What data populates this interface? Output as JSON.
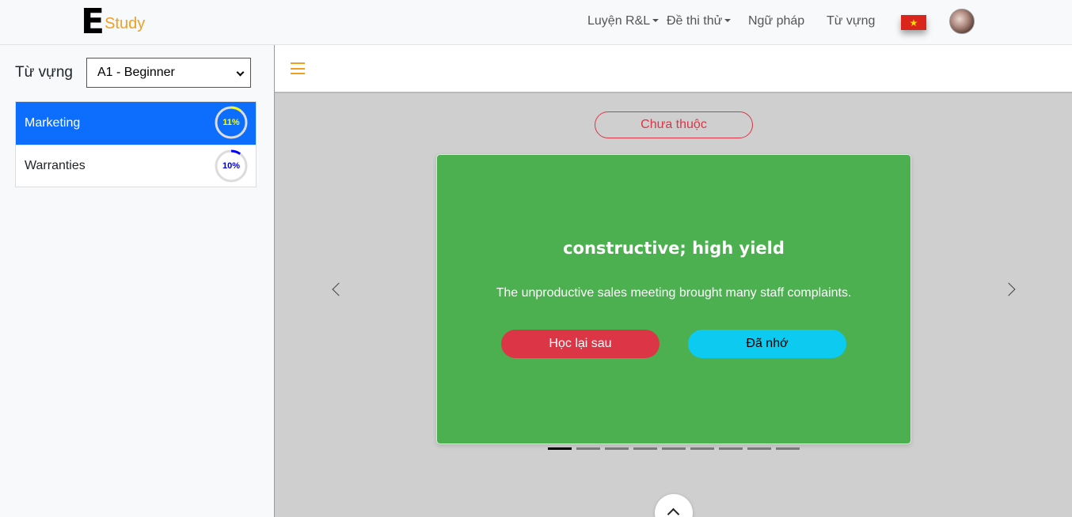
{
  "navbar": {
    "logo_e": "E",
    "logo_study": "Study",
    "items": [
      {
        "label": "Luyện R&L",
        "dropdown": true
      },
      {
        "label": "Đề thi thử",
        "dropdown": true
      },
      {
        "label": "Ngữ pháp",
        "dropdown": false
      },
      {
        "label": "Từ vựng",
        "dropdown": false
      }
    ],
    "flag_icon": "vietnam-flag-icon",
    "flag_star": "★",
    "avatar_icon": "user-avatar"
  },
  "sidebar": {
    "label": "Từ vựng",
    "level_select": {
      "value": "A1 - Beginner"
    },
    "topics": [
      {
        "label": "Marketing",
        "progress": 11,
        "progress_text": "11%",
        "active": true,
        "ring_color": "#ffff00"
      },
      {
        "label": "Warranties",
        "progress": 10,
        "progress_text": "10%",
        "active": false,
        "ring_color": "#0000ff"
      }
    ]
  },
  "main": {
    "menu_icon": "hamburger-menu-icon",
    "status_label": "Chưa thuộc",
    "card": {
      "word": "constructive; high yield",
      "example": "The unproductive sales meeting brought many staff complaints.",
      "learn_later_label": "Học lại sau",
      "remembered_label": "Đã nhớ",
      "color": "#4caf50"
    },
    "carousel": {
      "prev_icon": "chevron-left-icon",
      "next_icon": "chevron-right-icon",
      "indicator_count": 9,
      "active_index": 0
    },
    "scroll_top_icon": "chevron-up-icon"
  }
}
